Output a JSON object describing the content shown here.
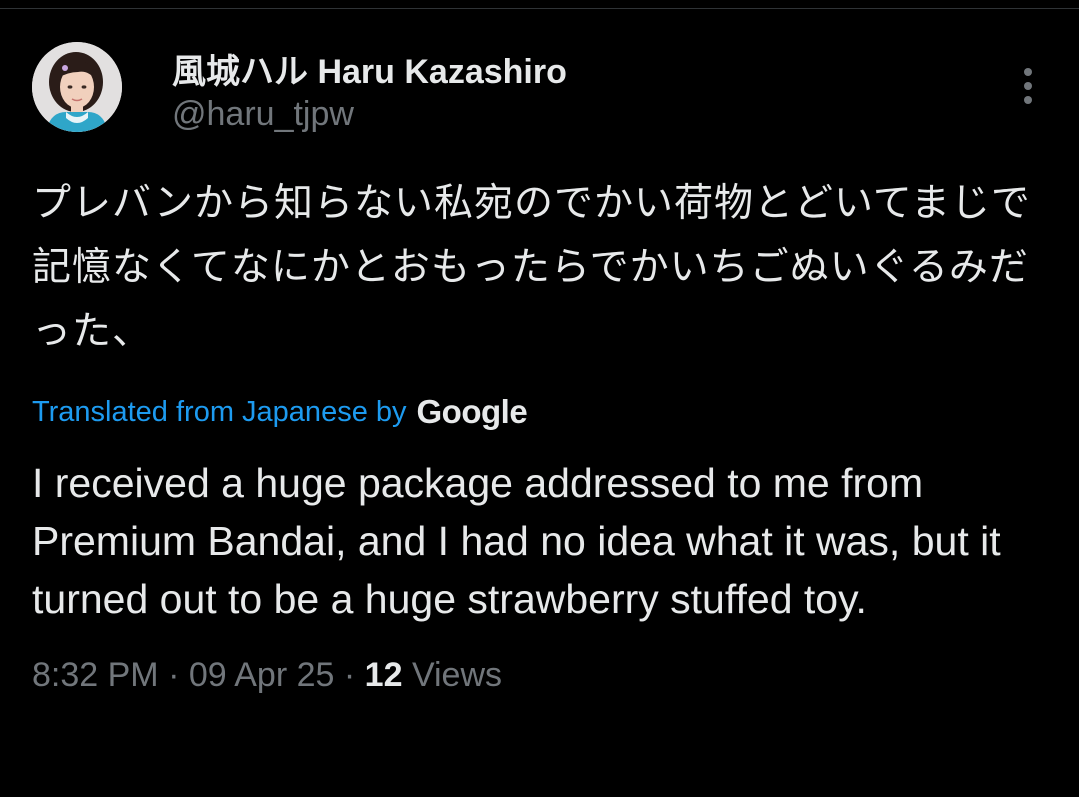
{
  "tweet": {
    "author": {
      "display_name": "風城ハル Haru Kazashiro",
      "handle": "@haru_tjpw",
      "avatar_icon": "profile-photo"
    },
    "more_icon": "more-dots-vertical-icon",
    "original_text": "プレバンから知らない私宛のでかい荷物とどいてまじで記憶なくてなにかとおもったらでかいちごぬいぐるみだった、",
    "translation": {
      "link_label": "Translated from Japanese by",
      "provider": "Google",
      "text": "I received a huge package addressed to me from Premium Bandai, and I had no idea what it was, but it turned out to be a huge strawberry stuffed toy."
    },
    "meta": {
      "time": "8:32 PM",
      "separator": "·",
      "date": "09 Apr 25",
      "views_count": "12",
      "views_label": "Views"
    }
  },
  "colors": {
    "background": "#000000",
    "text_primary": "#e7e9ea",
    "text_secondary": "#71767b",
    "link": "#1d9bf0",
    "divider": "#2f3336"
  }
}
